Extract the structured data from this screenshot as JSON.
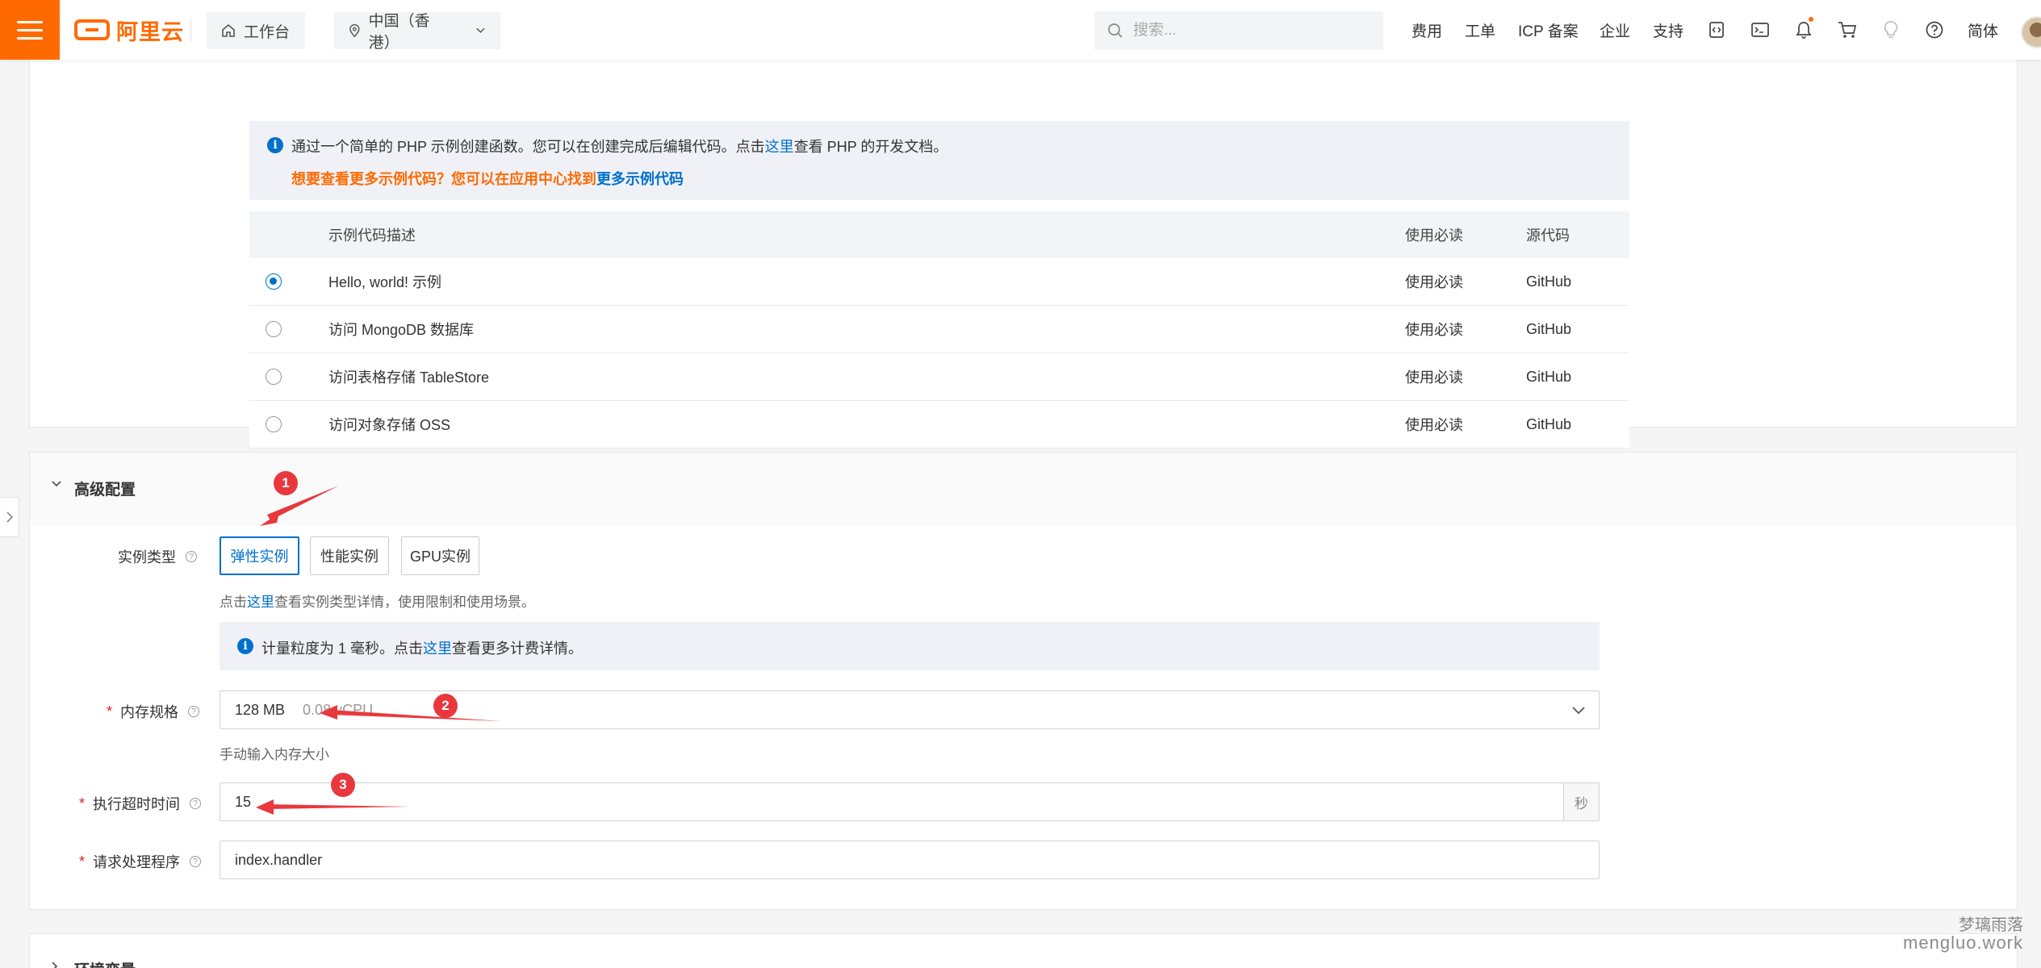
{
  "topbar": {
    "logo_text": "阿里云",
    "workbench": "工作台",
    "region": "中国（香港）",
    "search_placeholder": "搜索...",
    "links": {
      "fees": "费用",
      "ticket": "工单",
      "icp": "ICP 备案",
      "enterprise": "企业",
      "support": "支持",
      "lang": "简体"
    },
    "accent_color": "#ff6a00"
  },
  "code_section": {
    "info_text_pre": "通过一个简单的 PHP 示例创建函数。您可以在创建完成后编辑代码。点击",
    "info_link": "这里",
    "info_text_post": "查看 PHP 的开发文档。",
    "more_text": "想要查看更多示例代码？您可以在应用中心找到",
    "more_link": "更多示例代码",
    "table": {
      "headers": {
        "desc": "示例代码描述",
        "readme": "使用必读",
        "source": "源代码"
      },
      "rows": [
        {
          "desc": "Hello, world! 示例",
          "readme": "使用必读",
          "source": "GitHub",
          "selected": true
        },
        {
          "desc": "访问 MongoDB 数据库",
          "readme": "使用必读",
          "source": "GitHub",
          "selected": false
        },
        {
          "desc": "访问表格存储 TableStore",
          "readme": "使用必读",
          "source": "GitHub",
          "selected": false
        },
        {
          "desc": "访问对象存储 OSS",
          "readme": "使用必读",
          "source": "GitHub",
          "selected": false
        }
      ]
    }
  },
  "advanced": {
    "title": "高级配置",
    "instance_type": {
      "label": "实例类型",
      "options": [
        "弹性实例",
        "性能实例",
        "GPU实例"
      ],
      "selected": "弹性实例",
      "hint_pre": "点击",
      "hint_link": "这里",
      "hint_post": "查看实例类型详情，使用限制和使用场景。"
    },
    "billing_info": {
      "pre": "计量粒度为 1 毫秒。点击",
      "link": "这里",
      "post": "查看更多计费详情。"
    },
    "memory": {
      "label": "内存规格",
      "value": "128 MB",
      "cpu": "0.08 vCPU",
      "manual_link": "手动输入内存大小"
    },
    "timeout": {
      "label": "执行超时时间",
      "value": "15",
      "unit": "秒"
    },
    "handler": {
      "label": "请求处理程序",
      "value": "index.handler"
    }
  },
  "env_section": {
    "title": "环境变量"
  },
  "annotations": [
    "1",
    "2",
    "3"
  ],
  "watermark": {
    "cn": "梦璃雨落",
    "en": "mengluo.work"
  }
}
